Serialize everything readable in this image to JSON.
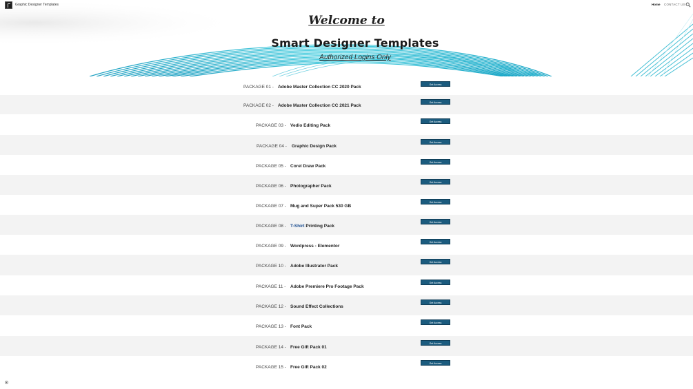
{
  "header": {
    "site_title": "Graphic Designer Templates",
    "nav": {
      "home": "Home",
      "contact": "CONTACT US"
    },
    "icons": {
      "search": "search-icon"
    }
  },
  "hero": {
    "welcome": "Welcome to",
    "brand": "Smart Designer Templates",
    "tagline": "Authorized Logins Only"
  },
  "packages": [
    {
      "num": "PACKAGE 01 -",
      "name": "Adobe Master Collection CC 2020 Pack",
      "button": "Get Access"
    },
    {
      "num": "PACKAGE 02 -",
      "name": "Adobe Master Collection CC 2021 Pack",
      "button": "Get Access"
    },
    {
      "num": "PACKAGE 03 -",
      "name": "Vedio Editing Pack",
      "button": "Get Access"
    },
    {
      "num": "PACKAGE 04 -",
      "name": "Graphic Design Pack",
      "button": "Get Access"
    },
    {
      "num": "PACKAGE 05 -",
      "name": "Corel Draw Pack",
      "button": "Get Access"
    },
    {
      "num": "PACKAGE 06 -",
      "name": "Photographer Pack",
      "button": "Get Access"
    },
    {
      "num": "PACKAGE 07 -",
      "name": "Mug and Super Pack 530 GB",
      "button": "Get Access"
    },
    {
      "num": "PACKAGE 08 -",
      "name_prefix": "T-Shirt",
      "name": " Printing Pack",
      "button": "Get Access"
    },
    {
      "num": "PACKAGE 09 -",
      "name": "Wordpress - Elementor",
      "button": "Get Access"
    },
    {
      "num": "PACKAGE 10 -",
      "name": "Adobe Illustrator Pack",
      "button": "Get Access"
    },
    {
      "num": "PACKAGE 11 -",
      "name": "Adobe Premiere Pro Footage Pack",
      "button": "Get Access"
    },
    {
      "num": "PACKAGE 12 -",
      "name": "Sound Effect Collections",
      "button": "Get Access"
    },
    {
      "num": "PACKAGE 13 -",
      "name": "Font Pack",
      "button": "Get Access"
    },
    {
      "num": "PACKAGE 14 -",
      "name": "Free Gift Pack 01",
      "button": "Get Access"
    },
    {
      "num": "PACKAGE 15 -",
      "name": "Free Gift Pack 02",
      "button": "Get Access"
    }
  ],
  "colors": {
    "button": "#1b5b7e",
    "row_alt": "#f3f3f3",
    "accent_wave": "#23b6d0"
  },
  "footer": {
    "icon": "gear-icon"
  }
}
